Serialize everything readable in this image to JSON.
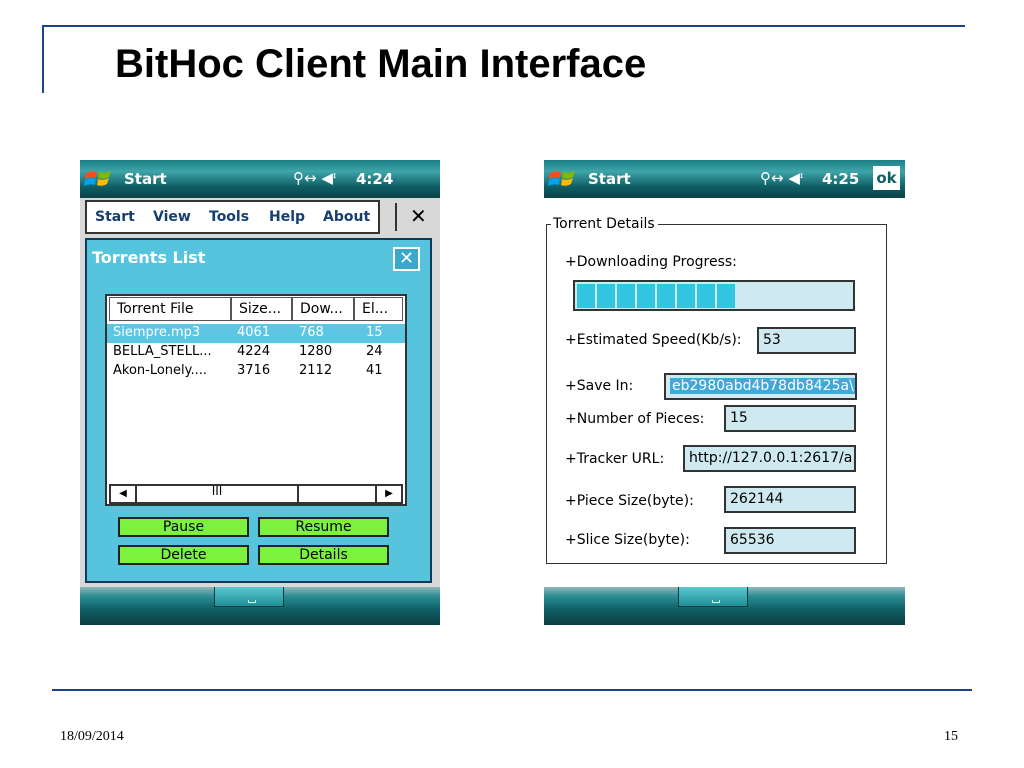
{
  "slide": {
    "title": "BitHoc Client Main Interface",
    "date": "18/09/2014",
    "page_number": "15"
  },
  "left_phone": {
    "status": {
      "start_label": "Start",
      "time": "4:24",
      "icons": "⚲↔ ◀ᶦ"
    },
    "menu": {
      "items": [
        "Start",
        "View",
        "Tools",
        "Help",
        "About"
      ],
      "close": "✕"
    },
    "dialog": {
      "title": "Torrents List",
      "close": "✕",
      "columns": [
        "Torrent File",
        "Size...",
        "Dow...",
        "El..."
      ],
      "rows": [
        {
          "file": "Siempre.mp3",
          "size": "4061",
          "dow": "768",
          "el": "15",
          "selected": true
        },
        {
          "file": "BELLA_STELL...",
          "size": "4224",
          "dow": "1280",
          "el": "24",
          "selected": false
        },
        {
          "file": "Akon-Lonely....",
          "size": "3716",
          "dow": "2112",
          "el": "41",
          "selected": false
        }
      ],
      "scroll_left": "◀",
      "scroll_right": "▶",
      "scroll_grip": "III",
      "buttons": {
        "pause": "Pause",
        "resume": "Resume",
        "delete": "Delete",
        "details": "Details"
      }
    }
  },
  "right_phone": {
    "status": {
      "start_label": "Start",
      "time": "4:25",
      "icons": "⚲↔ ◀ᶦ",
      "ok": "ok"
    },
    "details": {
      "legend": "Torrent Details",
      "progress_label": "+Downloading Progress:",
      "progress_fraction": 0.6,
      "speed_label": "+Estimated Speed(Kb/s):",
      "speed_value": "53",
      "save_label": "+Save In:",
      "save_value": "eb2980abd4b78db8425a\\",
      "pieces_label": "+Number of Pieces:",
      "pieces_value": "15",
      "tracker_label": "+Tracker URL:",
      "tracker_value": "http://127.0.0.1:2617/a",
      "piece_size_label": "+Piece Size(byte):",
      "piece_size_value": "262144",
      "slice_size_label": "+Slice Size(byte):",
      "slice_size_value": "65536"
    }
  }
}
